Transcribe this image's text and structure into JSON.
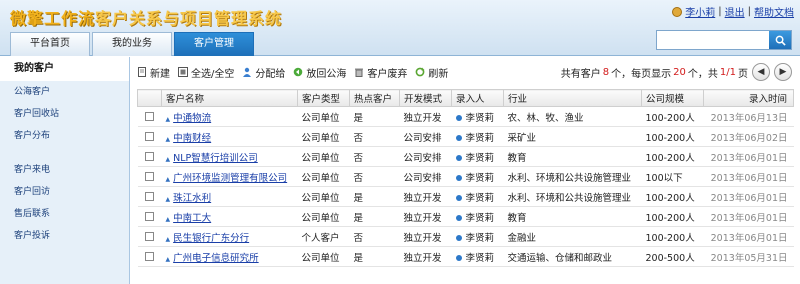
{
  "header": {
    "logo_part1": "微擎工作流",
    "logo_part2": "客户关系与项目管理系统",
    "user": "李小莉",
    "sep": "|",
    "logout": "退出",
    "help": "帮助文档",
    "tabs": [
      {
        "label": "平台首页"
      },
      {
        "label": "我的业务"
      },
      {
        "label": "客户管理"
      }
    ],
    "search_placeholder": ""
  },
  "sidebar": {
    "items": [
      {
        "label": "我的客户"
      },
      {
        "label": "公海客户"
      },
      {
        "label": "客户回收站"
      },
      {
        "label": "客户分布"
      },
      {
        "label": "客户来电"
      },
      {
        "label": "客户回访"
      },
      {
        "label": "售后联系"
      },
      {
        "label": "客户投诉"
      }
    ]
  },
  "toolbar": {
    "new": "新建",
    "select_all": "全选/全空",
    "assign": "分配给",
    "return_pool": "放回公海",
    "discard": "客户废弃",
    "refresh": "刷新"
  },
  "pager": {
    "prefix": "共有客户",
    "total": "8",
    "mid1": "个，每页显示",
    "per_page": "20",
    "mid2": "个，共",
    "page": "1/1",
    "suffix": "页"
  },
  "table": {
    "headers": [
      "客户名称",
      "客户类型",
      "热点客户",
      "开发模式",
      "录入人",
      "行业",
      "公司规模",
      "录入时间"
    ],
    "rows": [
      {
        "name": "中通物流",
        "type": "公司单位",
        "hot": "是",
        "mode": "独立开发",
        "user": "李贤莉",
        "industry": "农、林、牧、渔业",
        "size": "100-200人",
        "date": "2013年06月13日"
      },
      {
        "name": "中南财经",
        "type": "公司单位",
        "hot": "否",
        "mode": "公司安排",
        "user": "李贤莉",
        "industry": "采矿业",
        "size": "100-200人",
        "date": "2013年06月02日"
      },
      {
        "name": "NLP智慧行培训公司",
        "type": "公司单位",
        "hot": "否",
        "mode": "公司安排",
        "user": "李贤莉",
        "industry": "教育",
        "size": "100-200人",
        "date": "2013年06月01日"
      },
      {
        "name": "广州环境监测管理有限公司",
        "type": "公司单位",
        "hot": "否",
        "mode": "公司安排",
        "user": "李贤莉",
        "industry": "水利、环境和公共设施管理业",
        "size": "100以下",
        "date": "2013年06月01日"
      },
      {
        "name": "珠江水利",
        "type": "公司单位",
        "hot": "是",
        "mode": "独立开发",
        "user": "李贤莉",
        "industry": "水利、环境和公共设施管理业",
        "size": "100-200人",
        "date": "2013年06月01日"
      },
      {
        "name": "中南工大",
        "type": "公司单位",
        "hot": "是",
        "mode": "独立开发",
        "user": "李贤莉",
        "industry": "教育",
        "size": "100-200人",
        "date": "2013年06月01日"
      },
      {
        "name": "民生银行广东分行",
        "type": "个人客户",
        "hot": "否",
        "mode": "独立开发",
        "user": "李贤莉",
        "industry": "金融业",
        "size": "100-200人",
        "date": "2013年06月01日"
      },
      {
        "name": "广州电子信息研究所",
        "type": "公司单位",
        "hot": "是",
        "mode": "独立开发",
        "user": "李贤莉",
        "industry": "交通运输、仓储和邮政业",
        "size": "200-500人",
        "date": "2013年05月31日"
      }
    ]
  }
}
